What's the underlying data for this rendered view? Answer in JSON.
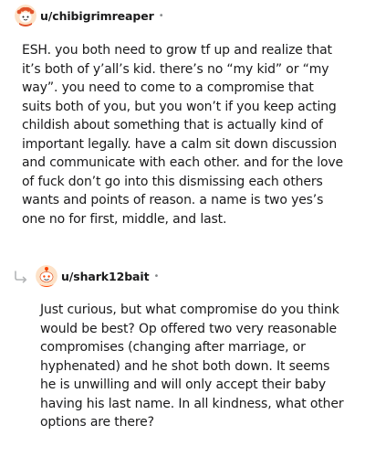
{
  "comments": [
    {
      "username": "u/chibigrimreaper",
      "separator": "•",
      "avatar_icon": "snoo-avatar-icon",
      "body": "ESH. you both need to grow tf up and realize that it’s both of y’all’s kid. there’s no “my kid” or “my way”. you need to come to a compromise that suits both of you, but you won’t if you keep acting childish about something that is actually kind of important legally. have a calm sit down discussion and communicate with each other. and for the love of fuck don’t go into this dismissing each others wants and points of reason. a name is two yes’s one no for first, middle, and last."
    },
    {
      "username": "u/shark12bait",
      "separator": "•",
      "avatar_icon": "snoo-avatar-icon",
      "reply_icon": "reply-arrow-icon",
      "body": "Just curious, but what compromise do you think would be best? Op offered two very reasonable compromises (changing after marriage, or hyphenated) and he shot both down. It seems he is unwilling and will only accept their baby having his last name. In all kindness, what other options are there?"
    }
  ],
  "colors": {
    "text": "#1a1a1b",
    "meta": "#878a8c",
    "avatar1": "#f5a623",
    "avatar2": "#ff4500"
  }
}
